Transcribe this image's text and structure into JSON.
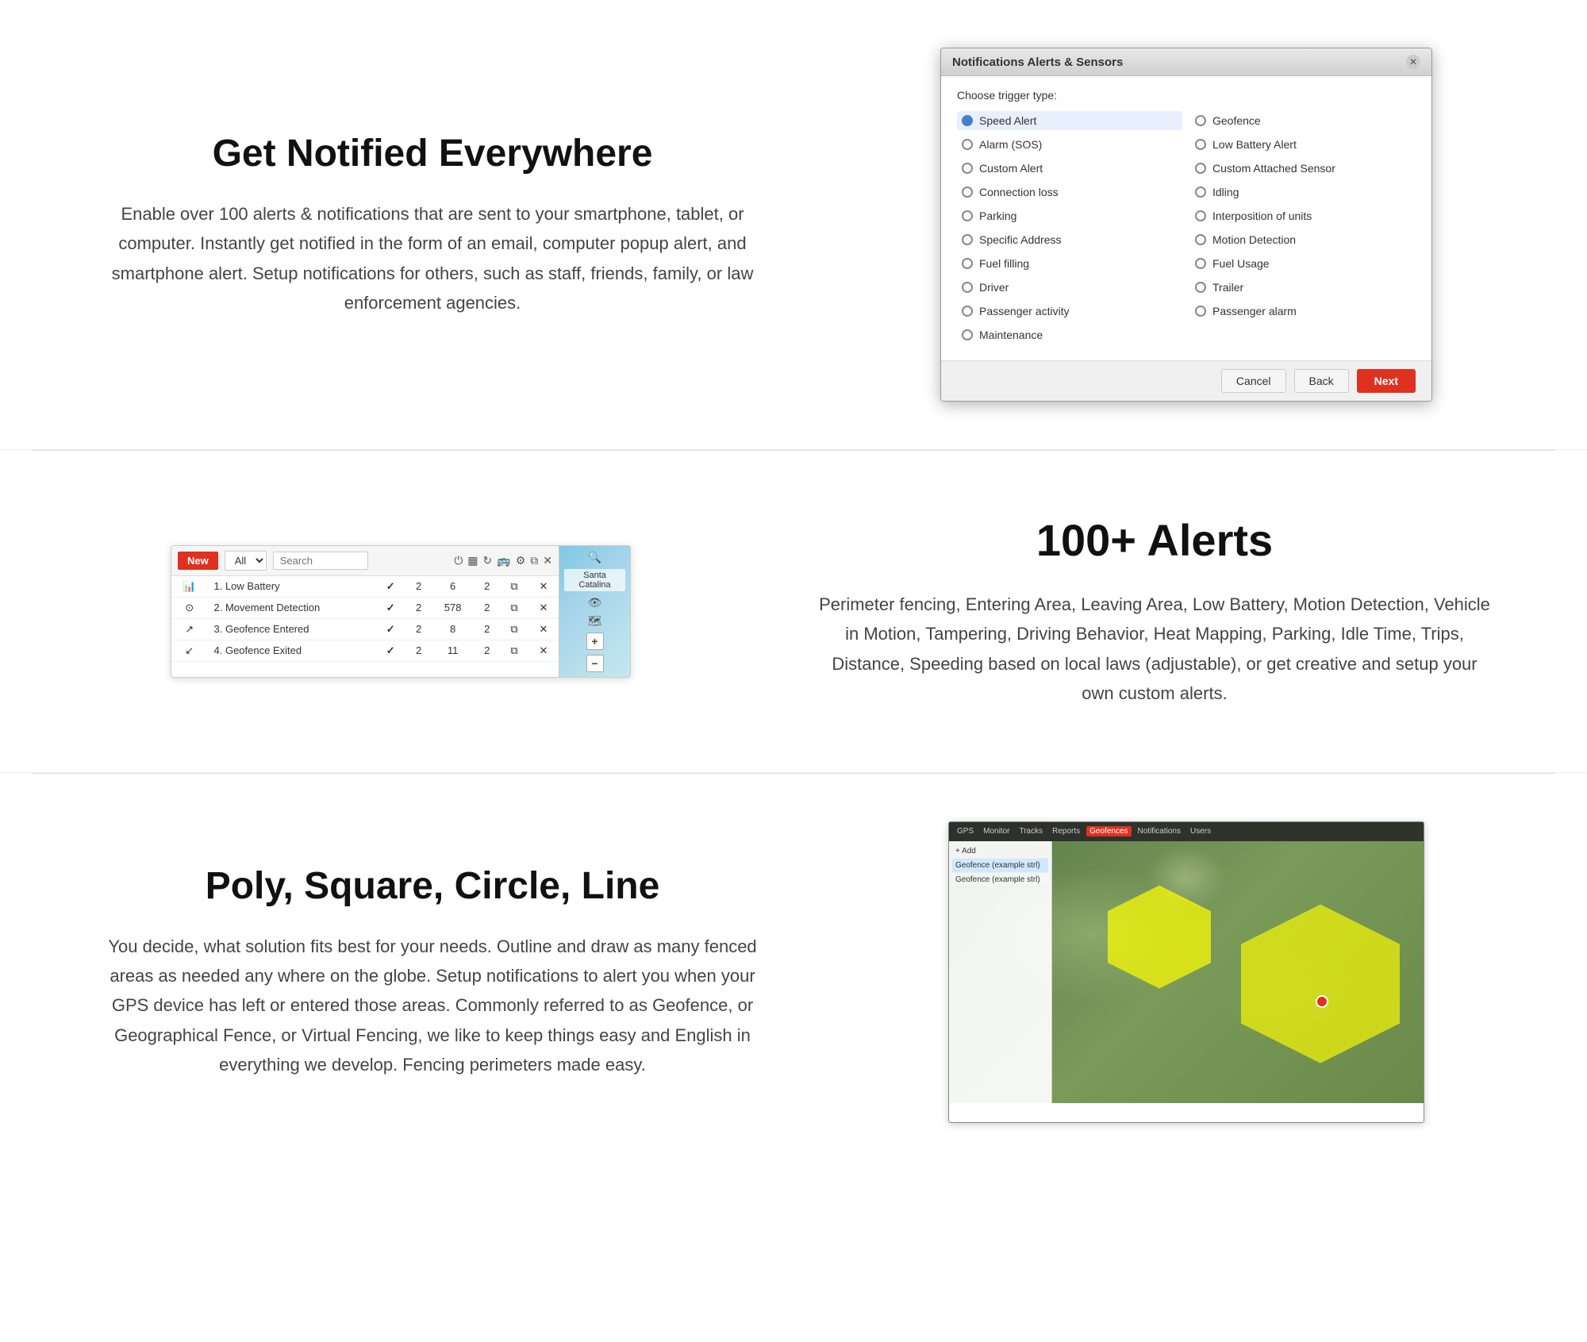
{
  "section1": {
    "title": "Get Notified Everywhere",
    "description": "Enable over 100 alerts & notifications that are sent to your smartphone, tablet, or computer. Instantly get notified in the form of an email, computer popup alert, and smartphone alert. Setup notifications for others, such as staff, friends, family, or law enforcement agencies."
  },
  "dialog": {
    "title": "Notifications Alerts & Sensors",
    "trigger_label": "Choose trigger type:",
    "options_left": [
      {
        "label": "Speed Alert",
        "selected": true
      },
      {
        "label": "Alarm (SOS)",
        "selected": false
      },
      {
        "label": "Custom Alert",
        "selected": false
      },
      {
        "label": "Connection loss",
        "selected": false
      },
      {
        "label": "Parking",
        "selected": false
      },
      {
        "label": "Specific Address",
        "selected": false
      },
      {
        "label": "Fuel filling",
        "selected": false
      },
      {
        "label": "Driver",
        "selected": false
      },
      {
        "label": "Passenger activity",
        "selected": false
      },
      {
        "label": "Maintenance",
        "selected": false
      }
    ],
    "options_right": [
      {
        "label": "Geofence",
        "selected": false
      },
      {
        "label": "Low Battery Alert",
        "selected": false
      },
      {
        "label": "Custom Attached Sensor",
        "selected": false
      },
      {
        "label": "Idling",
        "selected": false
      },
      {
        "label": "Interposition of units",
        "selected": false
      },
      {
        "label": "Motion Detection",
        "selected": false
      },
      {
        "label": "Fuel Usage",
        "selected": false
      },
      {
        "label": "Trailer",
        "selected": false
      },
      {
        "label": "Passenger alarm",
        "selected": false
      }
    ],
    "cancel_label": "Cancel",
    "back_label": "Back",
    "next_label": "Next"
  },
  "section2": {
    "title": "100+ Alerts",
    "description": "Perimeter fencing, Entering Area, Leaving Area, Low Battery, Motion Detection, Vehicle in Motion, Tampering, Driving Behavior, Heat Mapping, Parking, Idle Time, Trips, Distance, Speeding based on local laws (adjustable), or get creative and setup your own custom alerts.",
    "toolbar": {
      "new_label": "New",
      "filter_options": [
        "All"
      ],
      "search_placeholder": "Search"
    },
    "alerts": [
      {
        "id": 1,
        "name": "Low Battery",
        "check": true,
        "col2": "2",
        "col3": "6",
        "col4": "2"
      },
      {
        "id": 2,
        "name": "Movement Detection",
        "check": true,
        "col2": "2",
        "col3": "578",
        "col4": "2"
      },
      {
        "id": 3,
        "name": "Geofence Entered",
        "check": true,
        "col2": "2",
        "col3": "8",
        "col4": "2"
      },
      {
        "id": 4,
        "name": "Geofence Exited",
        "check": true,
        "col2": "2",
        "col3": "11",
        "col4": "2"
      }
    ],
    "map_text": "Santa Catalina"
  },
  "section3": {
    "title": "Poly, Square, Circle, Line",
    "description": "You decide, what solution fits best for your needs. Outline and draw as many fenced areas as needed any where on the globe. Setup notifications to alert you when your GPS device has left or entered those areas. Commonly referred to as Geofence, or Geographical Fence, or Virtual Fencing, we like to keep things easy and English in everything we develop. Fencing perimeters made easy.",
    "geo_items": [
      {
        "label": "Geofence (example strl)"
      },
      {
        "label": "Geofence (example strl)"
      }
    ]
  }
}
